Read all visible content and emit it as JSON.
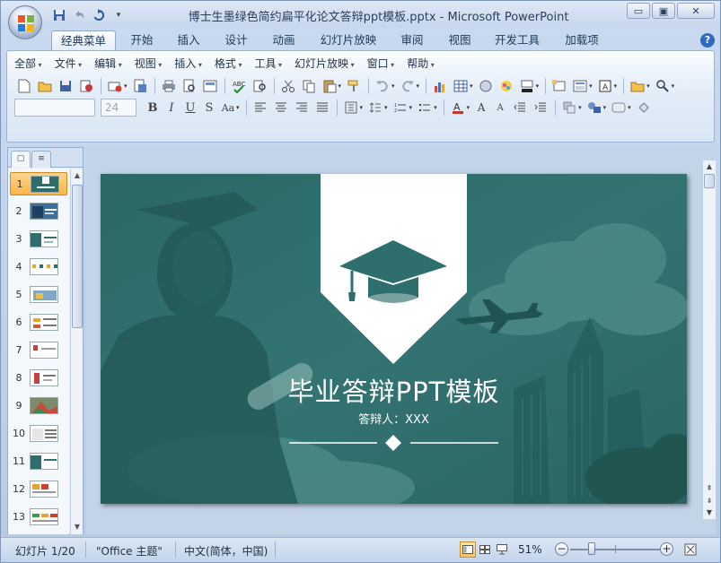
{
  "window": {
    "title": "博士生墨绿色简约扁平化论文答辩ppt模板.pptx - Microsoft PowerPoint",
    "controls": {
      "minimize": "▭",
      "restore": "▣",
      "close": "✕"
    }
  },
  "ribbon_tabs": [
    "经典菜单",
    "开始",
    "插入",
    "设计",
    "动画",
    "幻灯片放映",
    "审阅",
    "视图",
    "开发工具",
    "加载项"
  ],
  "active_tab": "经典菜单",
  "menu_bar": [
    "全部",
    "文件",
    "编辑",
    "视图",
    "插入",
    "格式",
    "工具",
    "幻灯片放映",
    "窗口",
    "帮助"
  ],
  "font": {
    "name_value": "",
    "size_value": "24"
  },
  "slides": {
    "numbers": [
      "1",
      "2",
      "3",
      "4",
      "5",
      "6",
      "7",
      "8",
      "9",
      "10",
      "11",
      "12",
      "13"
    ],
    "selected": "1"
  },
  "slide": {
    "title": "毕业答辩PPT模板",
    "subtitle": "答辩人：XXX",
    "theme_color": "#2e6e6c",
    "banner_color": "#ffffff",
    "cap_icon": "graduation-cap-icon"
  },
  "status": {
    "slide_info": "幻灯片 1/20",
    "theme": "\"Office 主题\"",
    "language": "中文(简体，中国)",
    "zoom": "51%",
    "zoom_level": 0.51
  }
}
